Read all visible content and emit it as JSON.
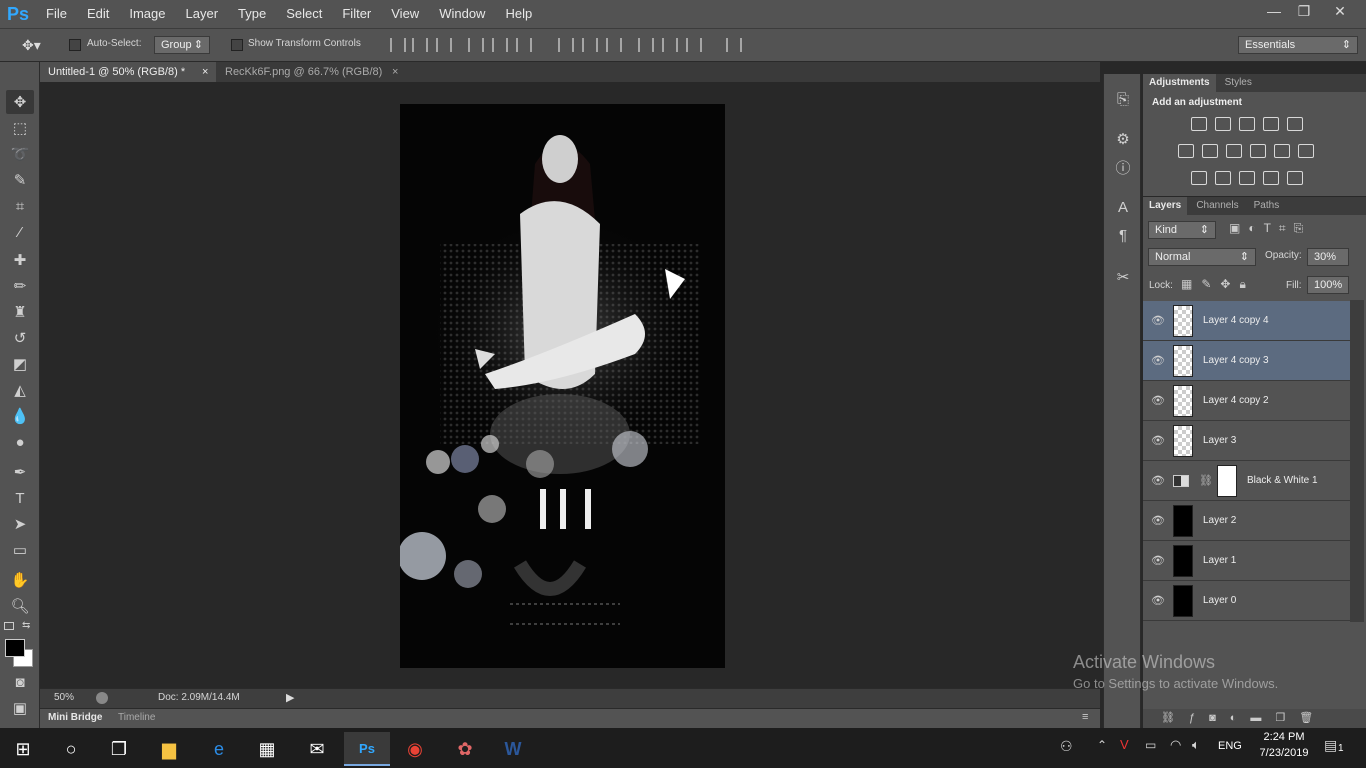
{
  "app": {
    "logo": "Ps"
  },
  "menu": [
    "File",
    "Edit",
    "Image",
    "Layer",
    "Type",
    "Select",
    "Filter",
    "View",
    "Window",
    "Help"
  ],
  "window_controls": {
    "minimize": "—",
    "restore": "❐",
    "close": "✕"
  },
  "options": {
    "auto_select_label": "Auto-Select:",
    "group_value": "Group",
    "show_transform_label": "Show Transform Controls",
    "workspace": "Essentials"
  },
  "tabs": [
    {
      "label": "Untitled-1 @ 50% (RGB/8) *",
      "close": "×",
      "active": true
    },
    {
      "label": "RecKk6F.png @ 66.7% (RGB/8)",
      "close": "×",
      "active": false
    }
  ],
  "status": {
    "zoom": "50%",
    "doc": "Doc: 2.09M/14.4M"
  },
  "bottom_tabs": [
    "Mini Bridge",
    "Timeline"
  ],
  "adjustments": {
    "tabs": [
      "Adjustments",
      "Styles"
    ],
    "heading": "Add an adjustment"
  },
  "layers_panel": {
    "tabs": [
      "Layers",
      "Channels",
      "Paths"
    ],
    "kind": "Kind",
    "blend_mode": "Normal",
    "opacity_label": "Opacity:",
    "opacity_value": "30%",
    "lock_label": "Lock:",
    "fill_label": "Fill:",
    "fill_value": "100%",
    "layers": [
      {
        "name": "Layer 4 copy 4",
        "selected": true
      },
      {
        "name": "Layer 4 copy 3",
        "selected": true
      },
      {
        "name": "Layer 4 copy 2",
        "selected": false
      },
      {
        "name": "Layer 3",
        "selected": false
      },
      {
        "name": "Black & White 1",
        "selected": false
      },
      {
        "name": "Layer 2",
        "selected": false
      },
      {
        "name": "Layer 1",
        "selected": false
      },
      {
        "name": "Layer 0",
        "selected": false
      }
    ]
  },
  "watermark": {
    "title": "Activate Windows",
    "subtitle": "Go to Settings to activate Windows."
  },
  "taskbar": {
    "lang": "ENG",
    "time": "2:24 PM",
    "date": "7/23/2019",
    "notif_count": "1"
  }
}
